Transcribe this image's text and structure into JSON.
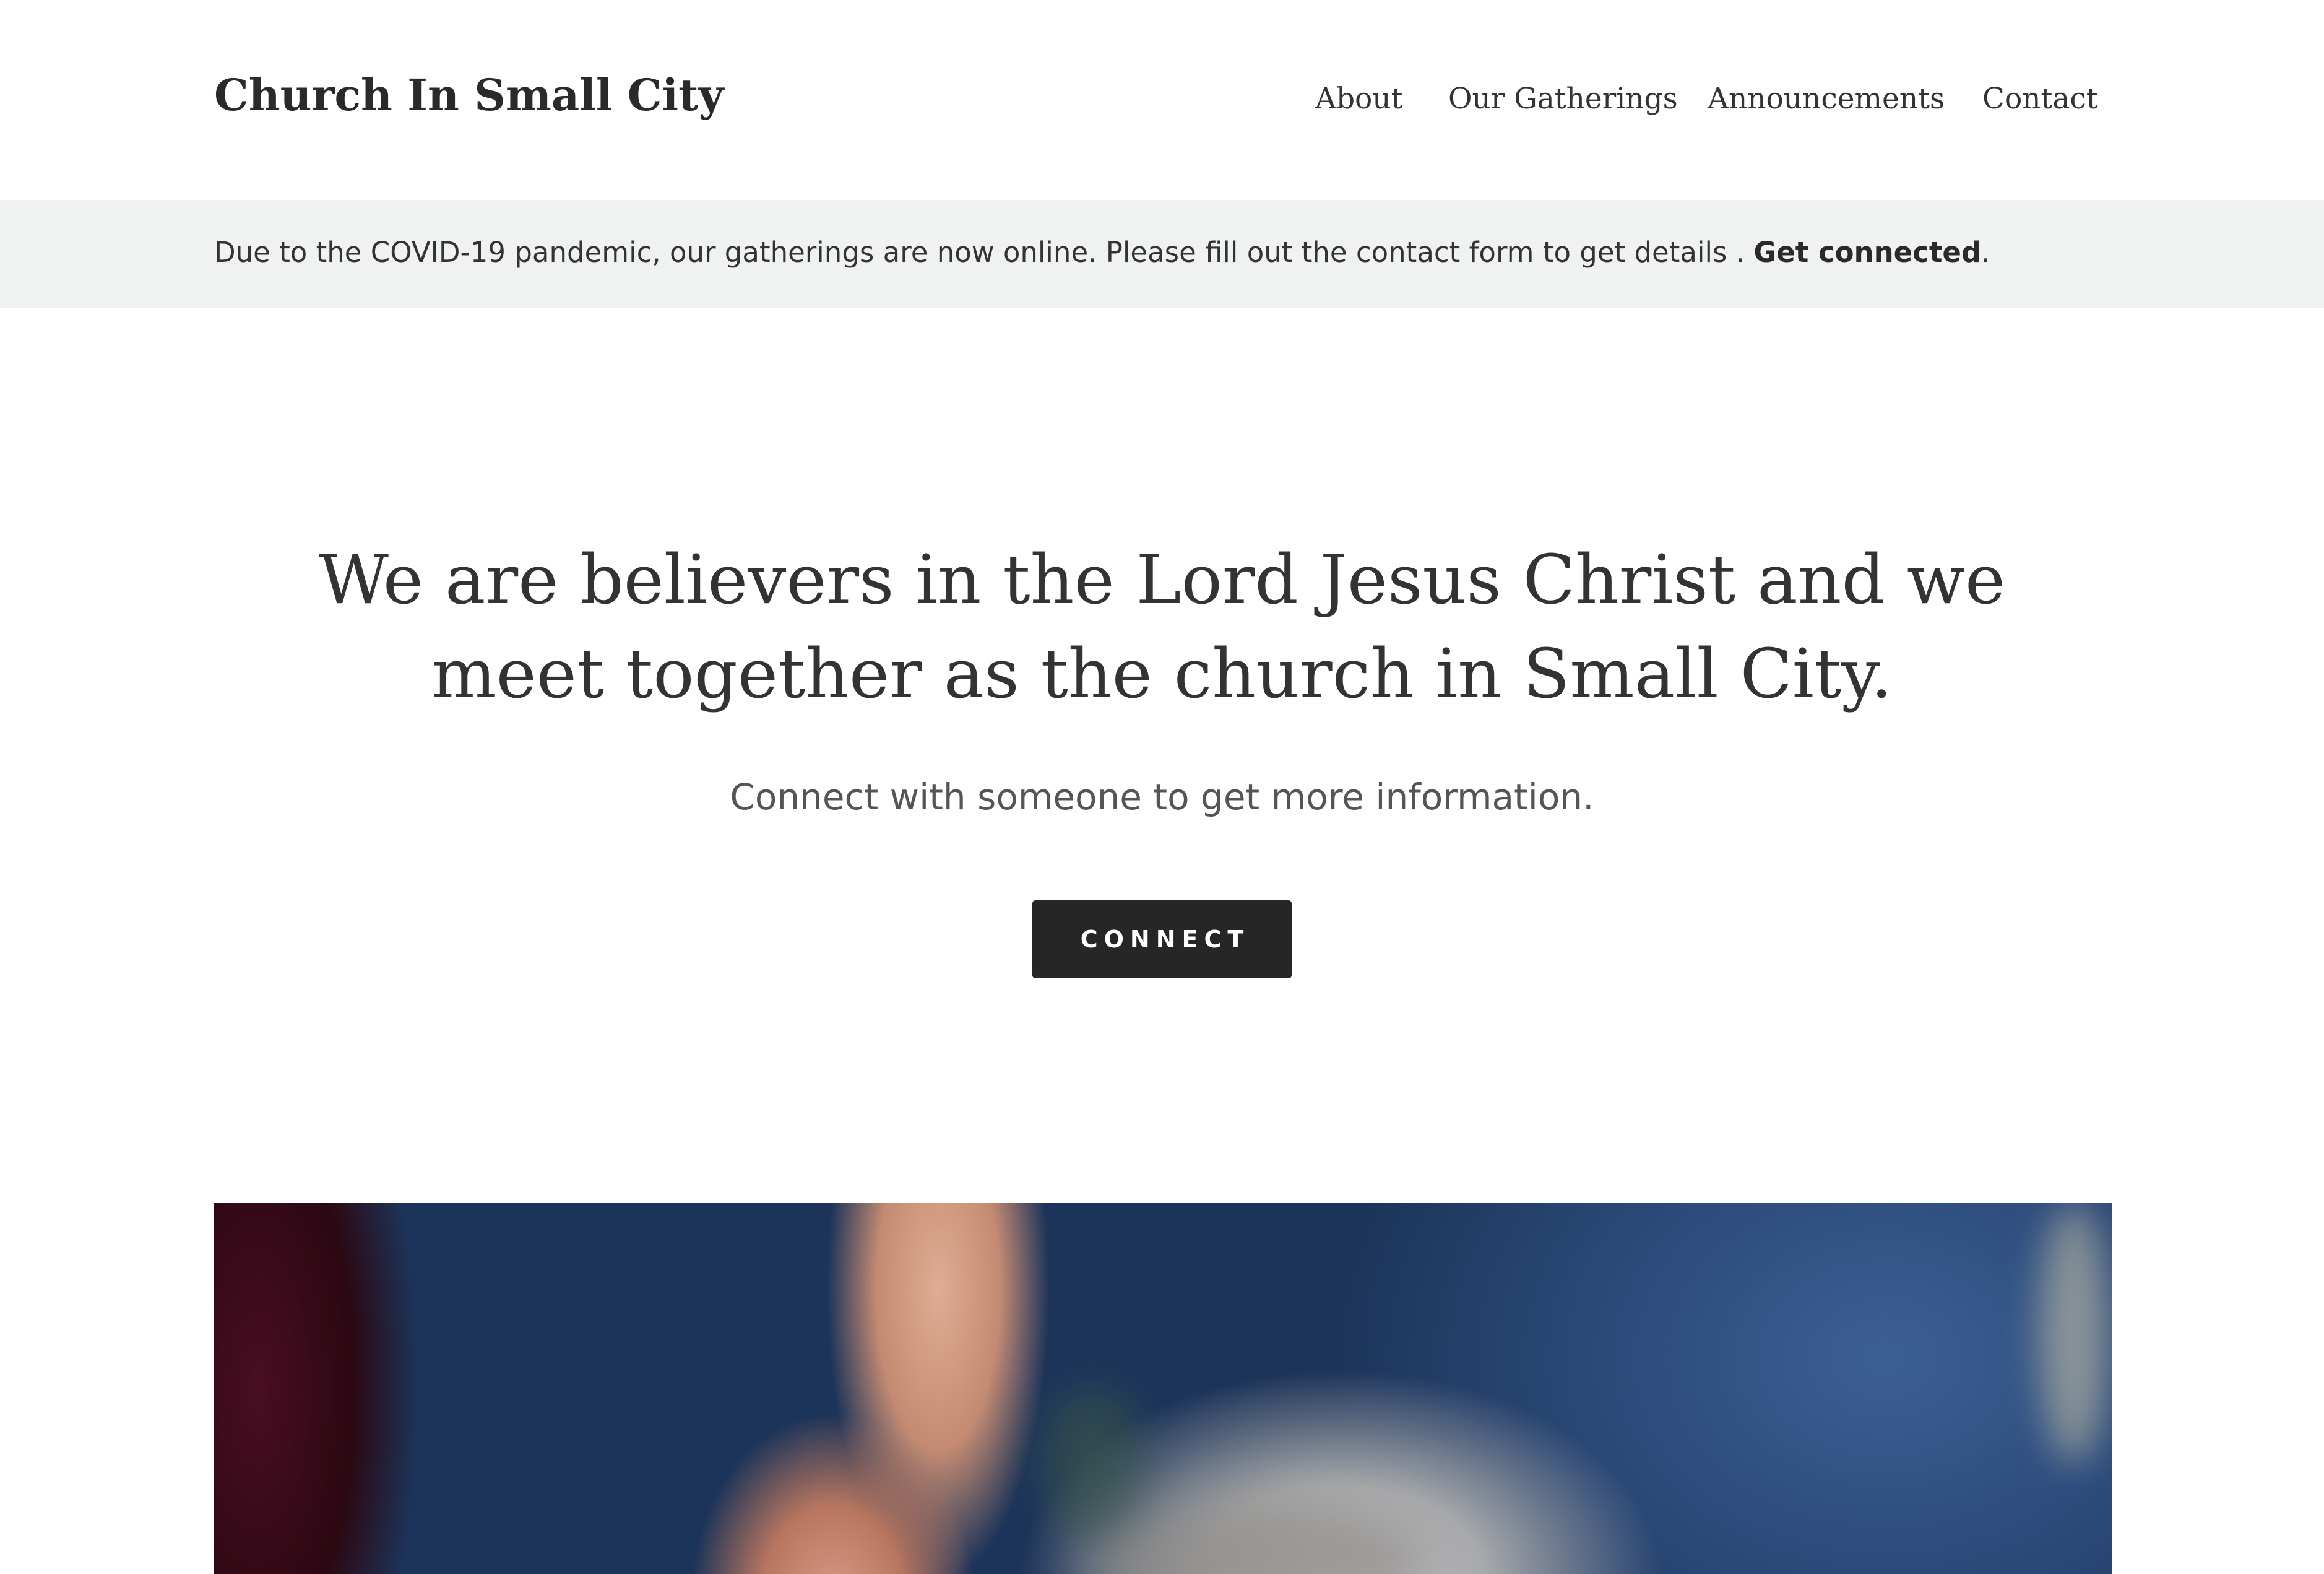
{
  "header": {
    "site_title": "Church In Small City",
    "nav": [
      {
        "label": "About"
      },
      {
        "label": "Our Gatherings"
      },
      {
        "label": "Announcements"
      },
      {
        "label": "Contact"
      }
    ]
  },
  "banner": {
    "text": "Due to the COVID-19 pandemic, our gatherings are now online. Please fill out the contact form to get details . ",
    "link_label": "Get connected",
    "trailing": "."
  },
  "hero": {
    "heading_line1": "We are believers in the Lord Jesus Christ and we",
    "heading_line2": "meet together as the church in Small City.",
    "subheading": "Connect with someone to get more information.",
    "button_label": "Connect"
  },
  "colors": {
    "background": "#ffffff",
    "banner_background": "#f0f2f1",
    "button_background": "#262626",
    "button_text": "#ffffff",
    "text": "#333333"
  }
}
